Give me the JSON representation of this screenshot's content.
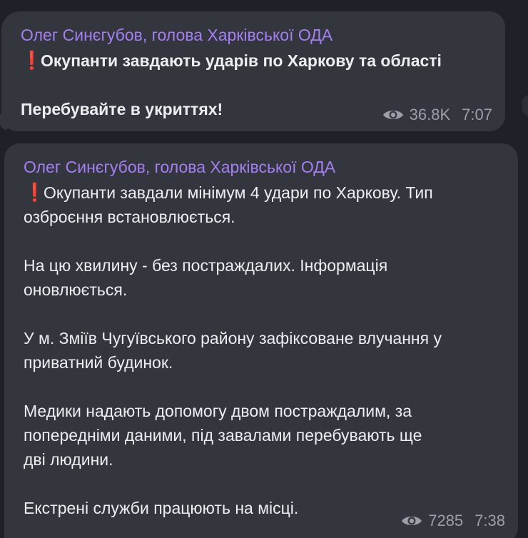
{
  "messages": [
    {
      "sender": "Олег Синєгубов, голова Харківської ОДА",
      "lines": [
        "Окупанти завдають ударів по Харкову та області",
        "",
        "Перебувайте в укриттях!"
      ],
      "views": "36.8K",
      "time": "7:07"
    },
    {
      "sender": "Олег Синєгубов, голова Харківської ОДА",
      "lines": [
        "Окупанти завдали мінімум 4 удари по Харкову. Тип",
        "озброєння встановлюється.",
        "",
        "На цю хвилину - без постраждалих. Інформація",
        "оновлюється.",
        "",
        "У м. Зміїв Чугуївського району зафіксоване влучання у",
        "приватний будинок.",
        "",
        "Медики надають допомогу двом постраждалим, за",
        "попередніми даними, під завалами перебувають ще",
        "дві людини.",
        "",
        "Екстрені служби працюють на місці."
      ],
      "views": "7285",
      "time": "7:38"
    }
  ],
  "icons": {
    "exclamation": "heavy-exclamation-mark-icon",
    "views": "eye-icon"
  },
  "colors": {
    "background": "#1e2127",
    "bubble": "#33363d",
    "sender": "#a57ef3",
    "text": "#eceef1",
    "meta": "#9a9fa8",
    "exclamation": "#e5262b"
  }
}
